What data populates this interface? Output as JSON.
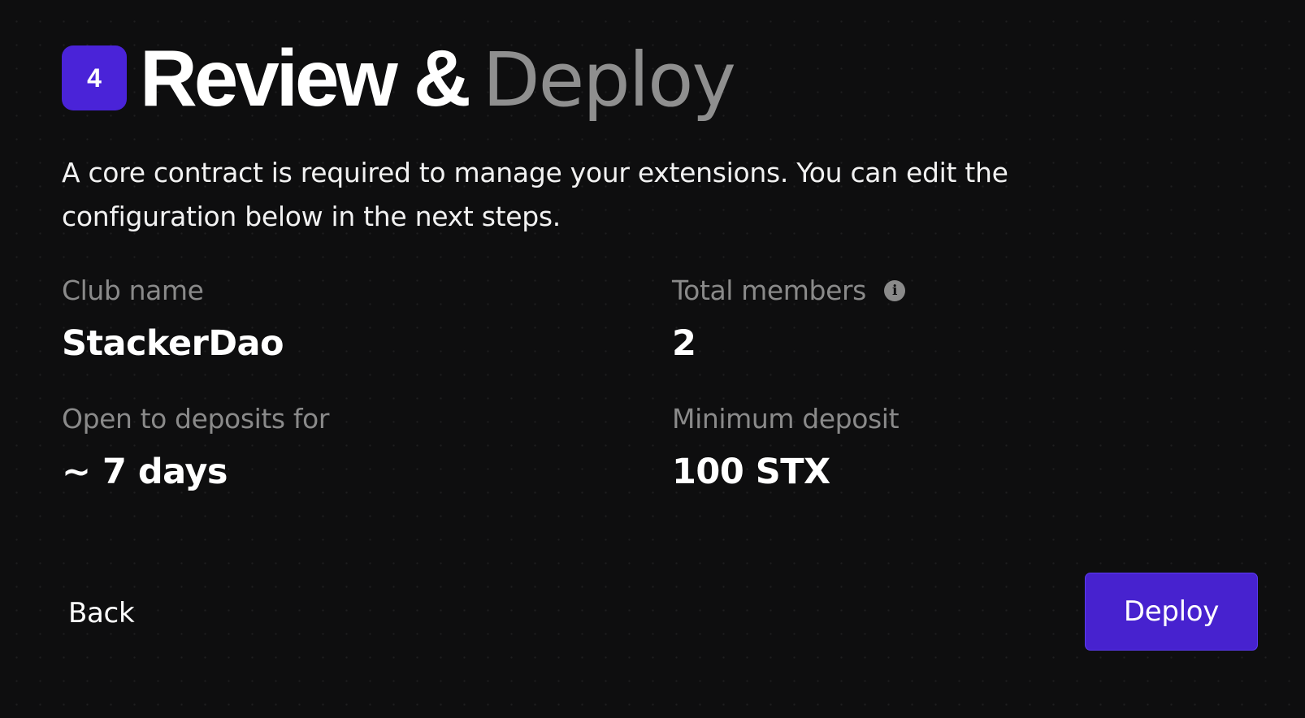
{
  "step": {
    "number": "4",
    "title_bold": "Review &",
    "title_light": "Deploy"
  },
  "description": "A core contract is required to manage your extensions. You can edit the configuration below in the next steps.",
  "fields": {
    "club_name": {
      "label": "Club name",
      "value": "StackerDao"
    },
    "total_members": {
      "label": "Total members",
      "value": "2",
      "icon": "info-icon"
    },
    "deposit_period": {
      "label": "Open to deposits for",
      "value": "~ 7 days"
    },
    "minimum_deposit": {
      "label": "Minimum deposit",
      "value": "100 STX"
    }
  },
  "actions": {
    "back_label": "Back",
    "deploy_label": "Deploy"
  },
  "colors": {
    "background": "#0e0e0f",
    "accent": "#4a23d8",
    "muted_text": "#8a8a8a"
  }
}
